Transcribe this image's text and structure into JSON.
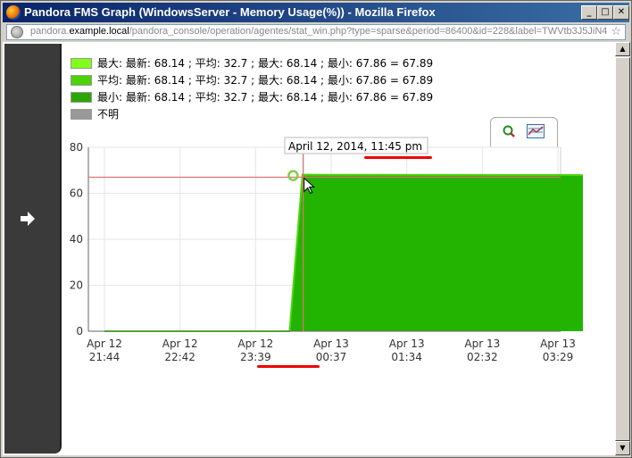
{
  "window": {
    "title": "Pandora FMS Graph (WindowsServer - Memory Usage(%)) - Mozilla Firefox",
    "minimize_glyph": "_",
    "maximize_glyph": "□",
    "close_glyph": "✕"
  },
  "address": {
    "prefix": "pandora.",
    "host": "example.local",
    "path": "/pandora_console/operation/agentes/stat_win.php?type=sparse&period=86400&id=228&label=TWVtb3J5JiN4"
  },
  "legend": [
    {
      "label": "最大: 最新: 68.14 ; 平均: 32.7 ; 最大: 68.14 ; 最小: 67.86 = 67.89",
      "color": "#80ff1a"
    },
    {
      "label": "平均: 最新: 68.14 ; 平均: 32.7 ; 最大: 68.14 ; 最小: 67.86 = 67.89",
      "color": "#4bd200"
    },
    {
      "label": "最小: 最新: 68.14 ; 平均: 32.7 ; 最大: 68.14 ; 最小: 67.86 = 67.89",
      "color": "#2ca600"
    },
    {
      "label": "不明",
      "color": "#999999"
    }
  ],
  "tooltip": "April 12, 2014, 11:45 pm",
  "chart_data": {
    "type": "area",
    "ylim": [
      0,
      80
    ],
    "y_ticks": [
      "0",
      "20",
      "40",
      "60",
      "80"
    ],
    "x_ticks": [
      {
        "l1": "Apr 12",
        "l2": "21:44"
      },
      {
        "l1": "Apr 12",
        "l2": "22:42"
      },
      {
        "l1": "Apr 12",
        "l2": "23:39"
      },
      {
        "l1": "Apr 13",
        "l2": "00:37"
      },
      {
        "l1": "Apr 13",
        "l2": "01:34"
      },
      {
        "l1": "Apr 13",
        "l2": "02:32"
      },
      {
        "l1": "Apr 13",
        "l2": "03:29"
      }
    ],
    "series_points": [
      [
        0,
        0
      ],
      [
        2.45,
        0
      ],
      [
        2.62,
        68.1
      ],
      [
        7,
        67.9
      ]
    ],
    "crosshair_value": 67,
    "crosshair_x": 2.63,
    "colors": {
      "fill": "#22b400",
      "edge": "#4fd60f",
      "crosshair": "#e07070"
    }
  }
}
